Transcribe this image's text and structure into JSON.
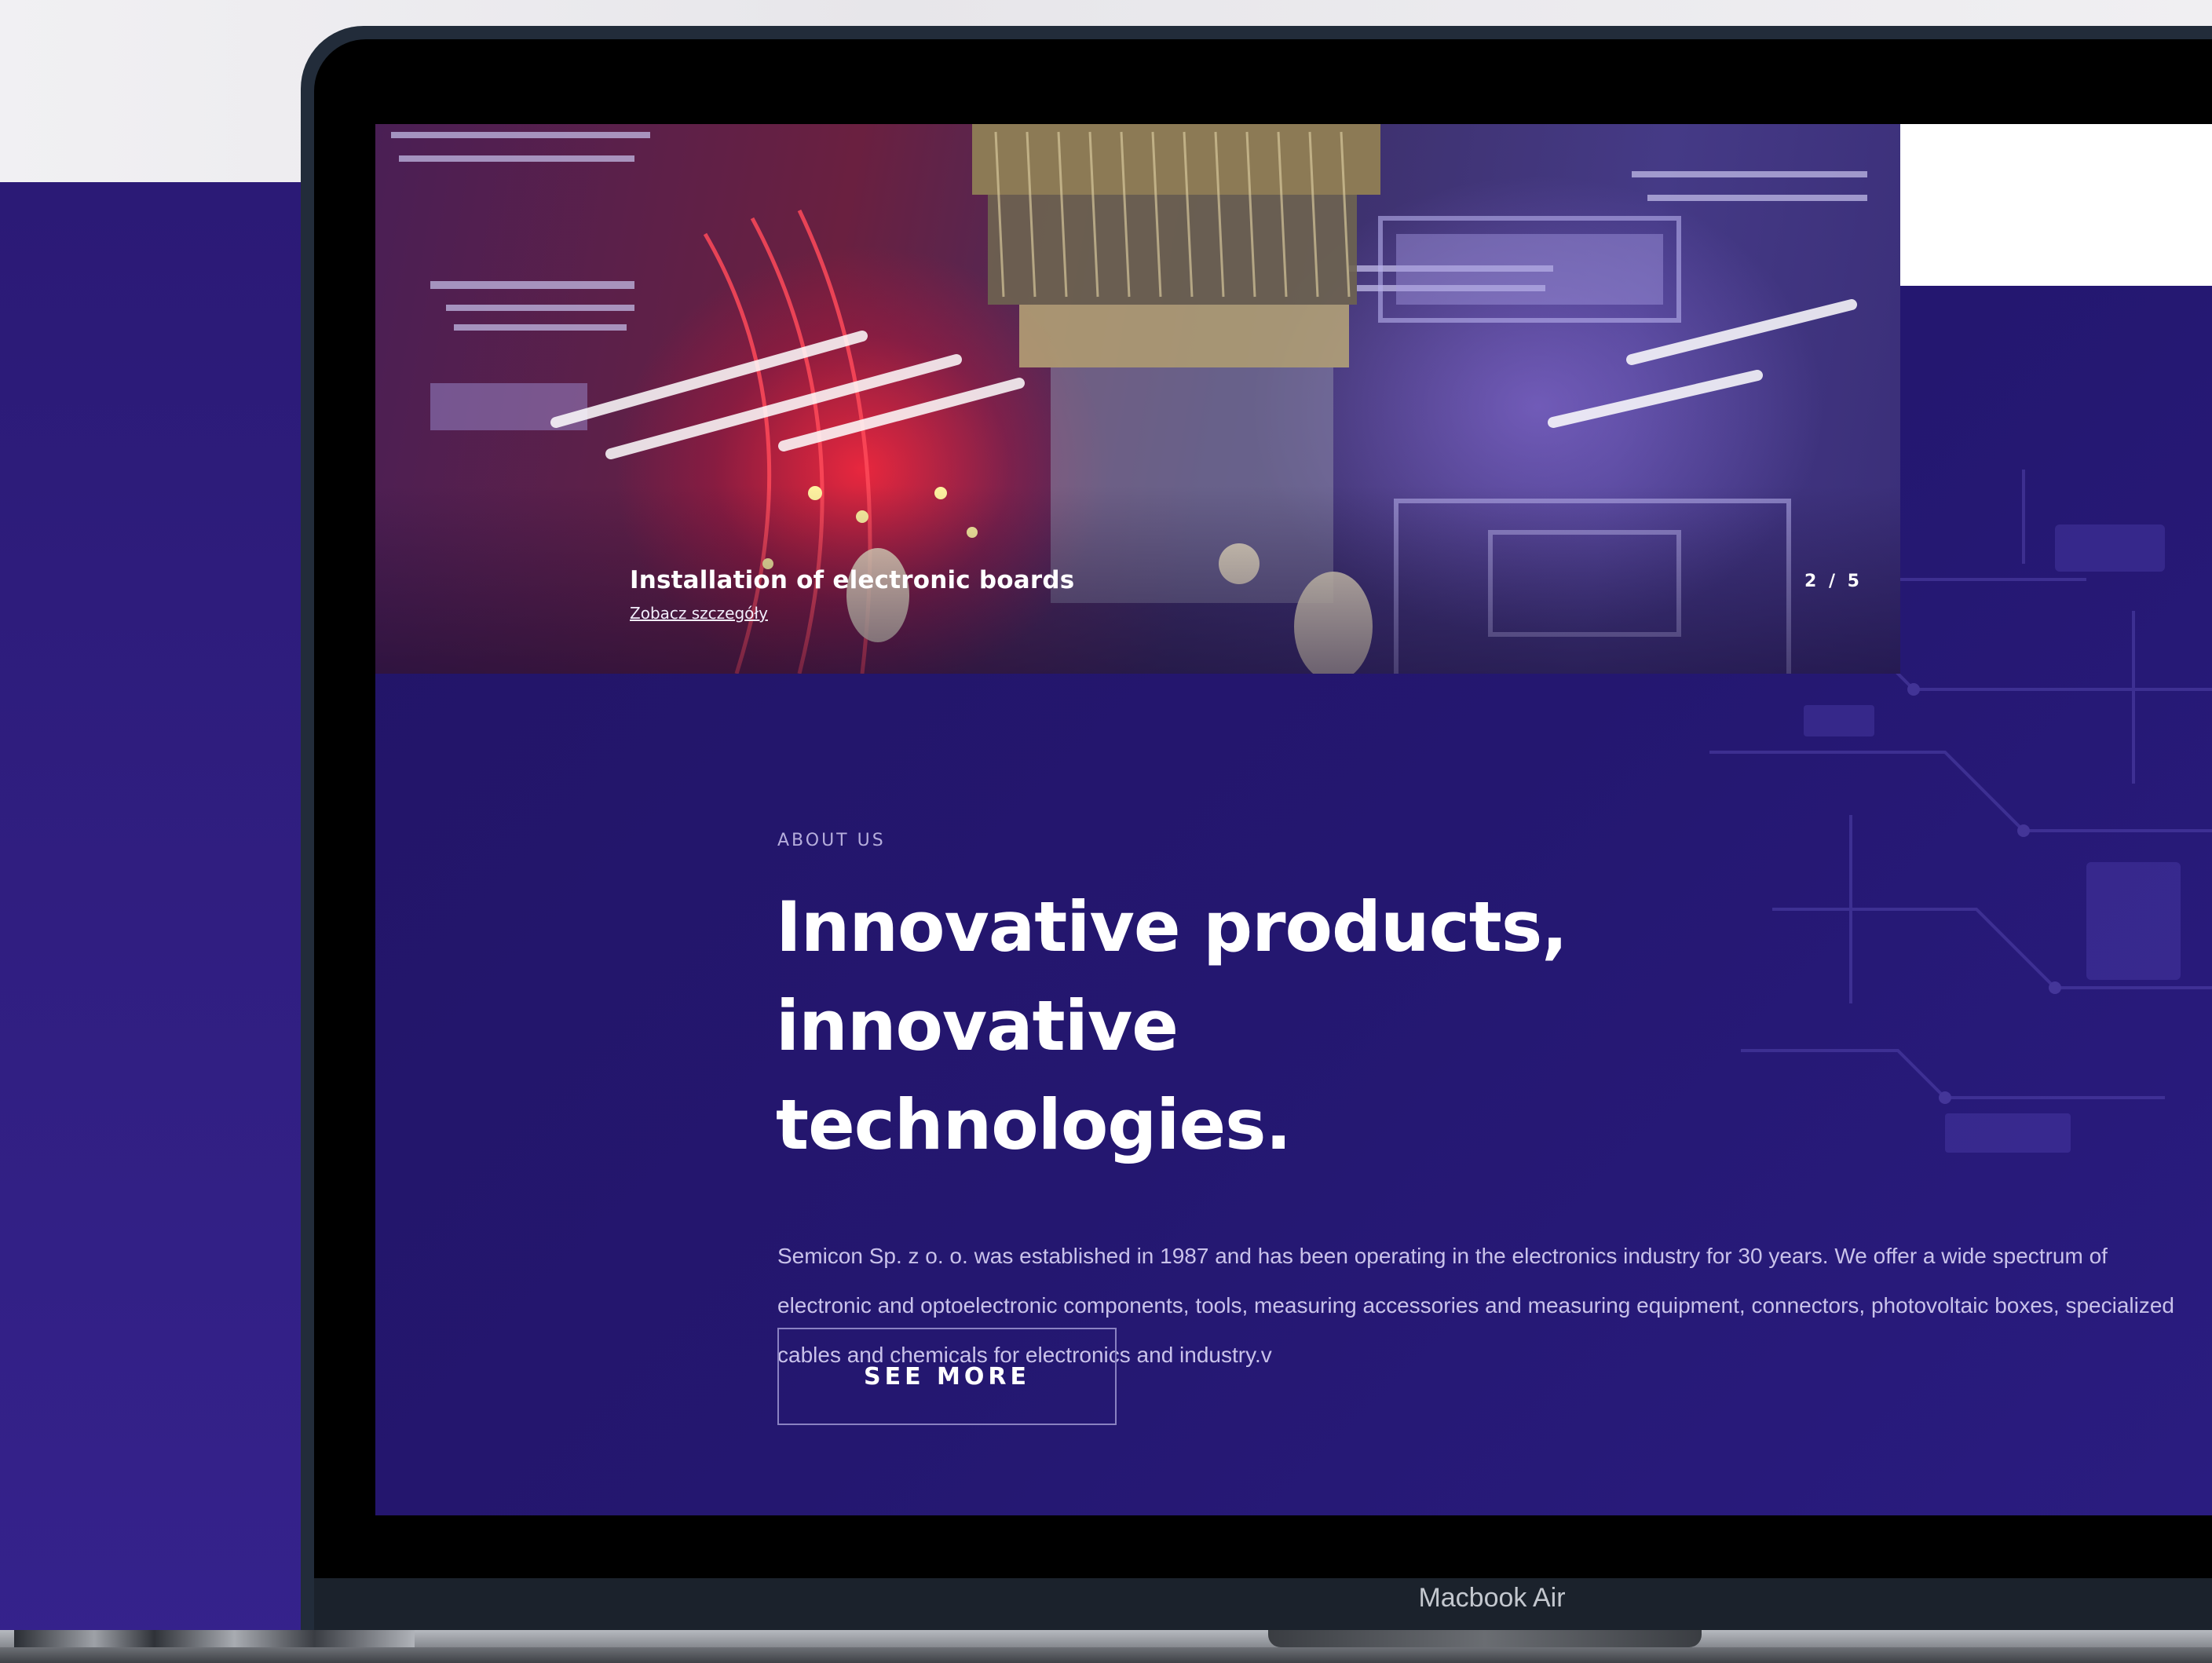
{
  "slider": {
    "slide_title": "Installation of electronic boards",
    "slide_link": "Zobacz szczegóły",
    "counter": "2 / 5",
    "current_slide": 2,
    "total_slides": 5
  },
  "about": {
    "eyebrow": "ABOUT US",
    "headline_line1": "Innovative products, innovative",
    "headline_line2": "technologies.",
    "paragraph": "Semicon Sp. z o. o. was established in 1987 and has been operating in the electronics industry for 30 years. We offer a wide spectrum of electronic and optoelectronic components, tools, measuring accessories and measuring equipment, connectors, photovoltaic boxes, specialized cables and chemicals for electronics and industry.v",
    "button_label": "SEE MORE"
  },
  "device": {
    "label": "Macbook Air"
  },
  "colors": {
    "section_background": "#241770",
    "page_purple": "#2f1d80",
    "accent_red": "#ff2a3c",
    "text_white": "#ffffff",
    "paragraph_text": "#c9c2ea",
    "button_border": "#8a82c2"
  }
}
